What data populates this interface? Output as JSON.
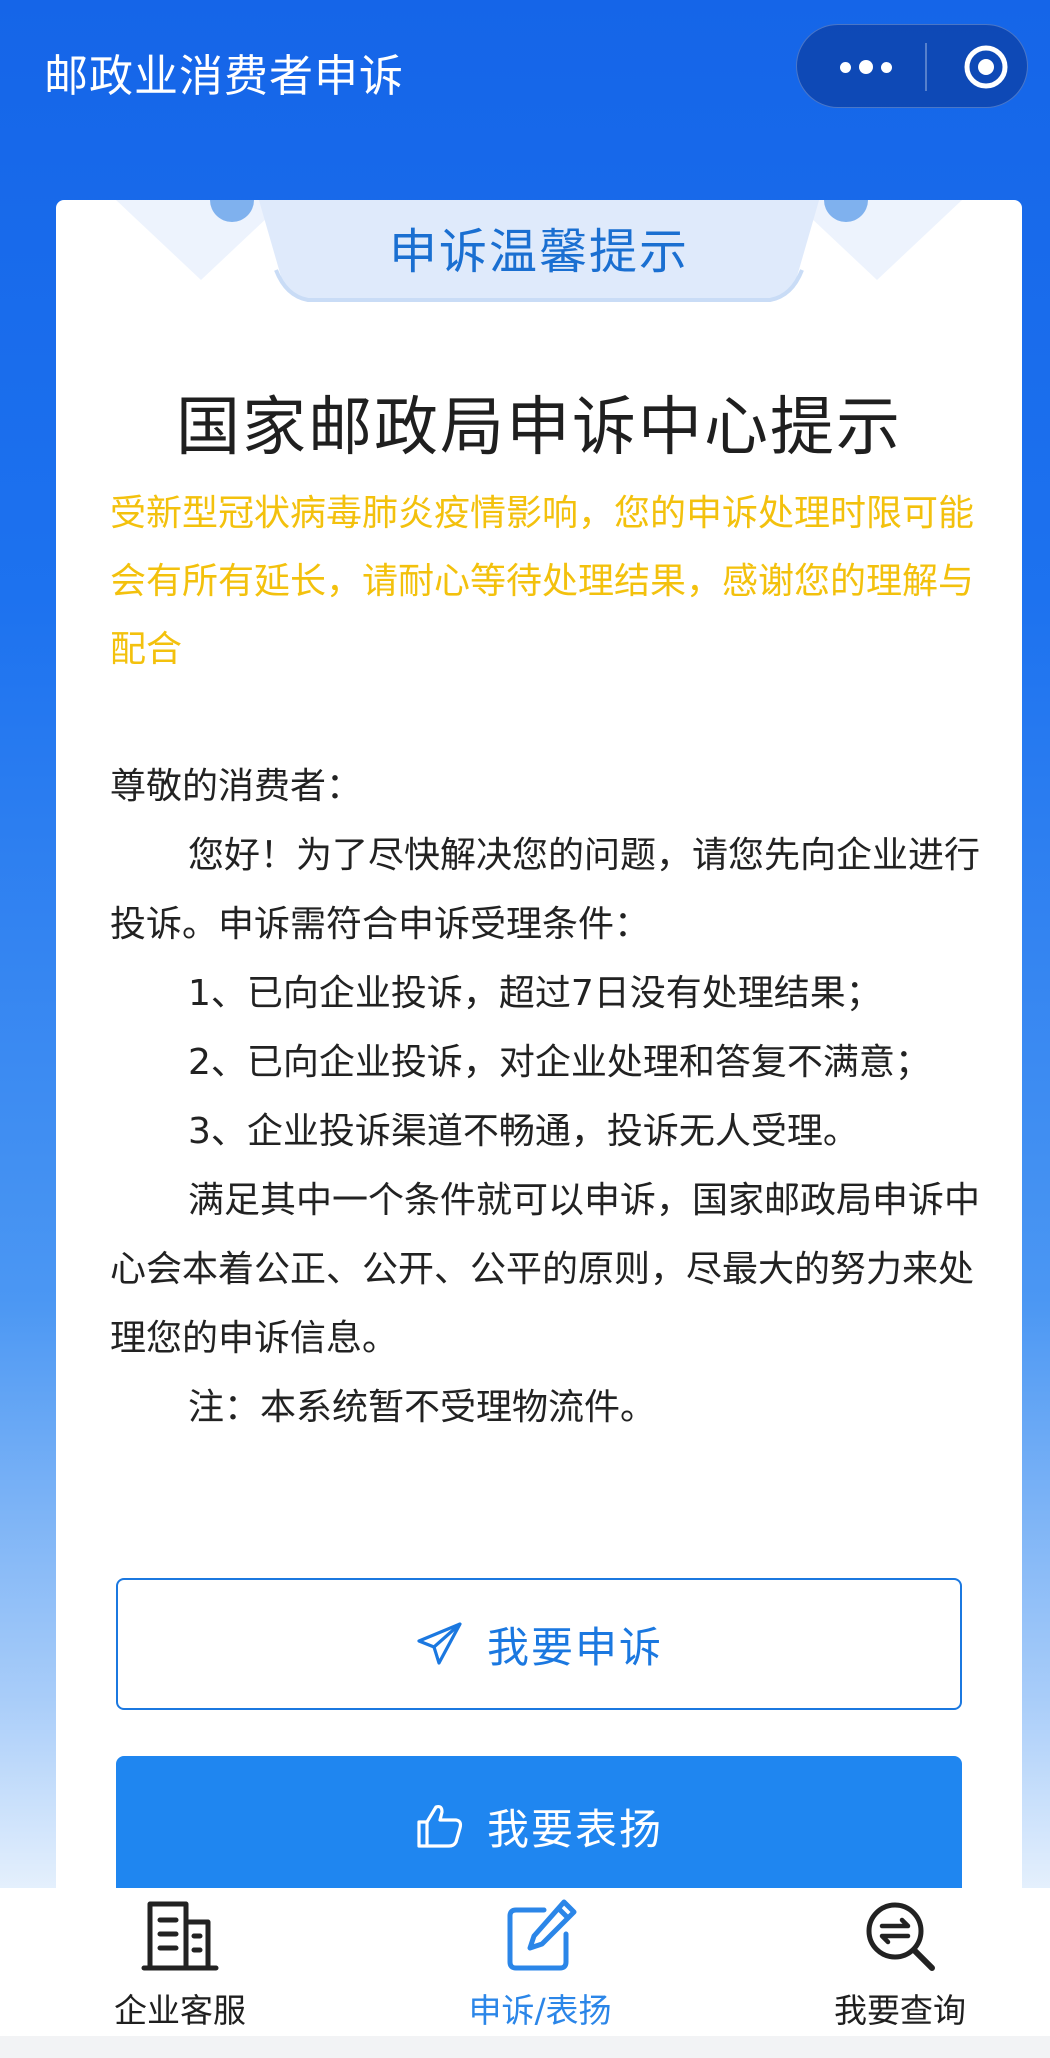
{
  "header": {
    "title": "邮政业消费者申诉",
    "more_icon": "more-dots-icon",
    "close_icon": "target-circle-icon"
  },
  "card": {
    "ribbon_title": "申诉温馨提示",
    "heading": "国家邮政局申诉中心提示",
    "notice": "受新型冠状病毒肺炎疫情影响，您的申诉处理时限可能会有所有延长，请耐心等待处理结果，感谢您的理解与配合",
    "greeting": "尊敬的消费者：",
    "intro": "您好！为了尽快解决您的问题，请您先向企业进行投诉。申诉需符合申诉受理条件：",
    "conditions": [
      "1、已向企业投诉，超过7日没有处理结果；",
      "2、已向企业投诉，对企业处理和答复不满意；",
      "3、企业投诉渠道不畅通，投诉无人受理。"
    ],
    "closing": "满足其中一个条件就可以申诉，国家邮政局申诉中心会本着公正、公开、公平的原则，尽最大的努力来处理您的申诉信息。",
    "note": "注：本系统暂不受理物流件。",
    "complaint_button": "我要申诉",
    "praise_button": "我要表扬"
  },
  "tabs": [
    {
      "label": "企业客服",
      "icon": "building-icon",
      "active": false
    },
    {
      "label": "申诉/表扬",
      "icon": "edit-icon",
      "active": true
    },
    {
      "label": "我要查询",
      "icon": "search-exchange-icon",
      "active": false
    }
  ],
  "colors": {
    "primary": "#1f86f0",
    "accent_text": "#1b78e0",
    "notice": "#f3c10d",
    "active_tab": "#2b86e8"
  }
}
